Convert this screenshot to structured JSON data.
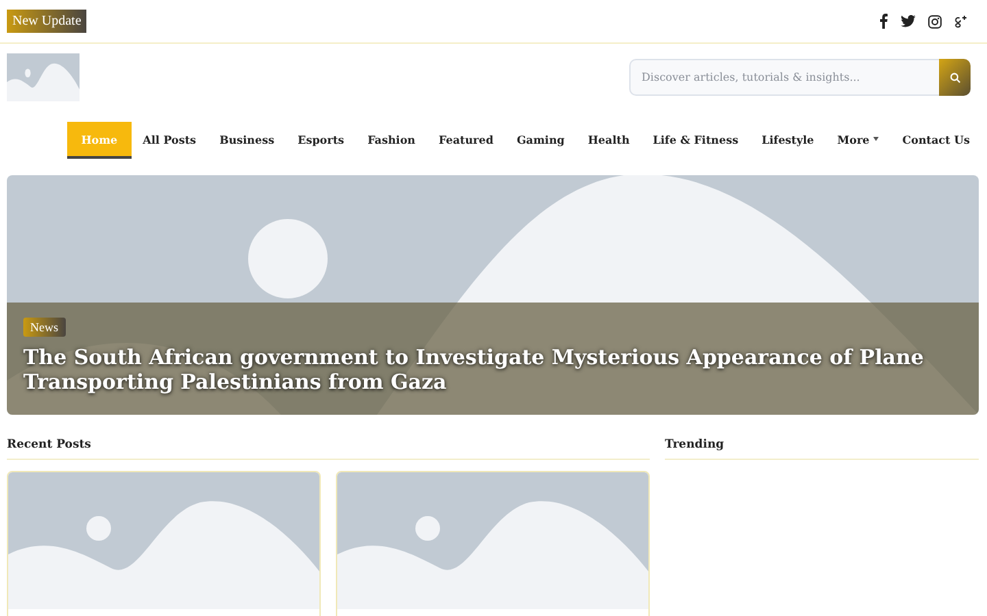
{
  "top_bar": {
    "badge": "New Update"
  },
  "search": {
    "placeholder": "Discover articles, tutorials & insights..."
  },
  "nav": [
    {
      "label": "Home",
      "selected": true,
      "dropdown": false
    },
    {
      "label": "All Posts",
      "selected": false,
      "dropdown": false
    },
    {
      "label": "Business",
      "selected": false,
      "dropdown": false
    },
    {
      "label": "Esports",
      "selected": false,
      "dropdown": false
    },
    {
      "label": "Fashion",
      "selected": false,
      "dropdown": false
    },
    {
      "label": "Featured",
      "selected": false,
      "dropdown": false
    },
    {
      "label": "Gaming",
      "selected": false,
      "dropdown": false
    },
    {
      "label": "Health",
      "selected": false,
      "dropdown": false
    },
    {
      "label": "Life & Fitness",
      "selected": false,
      "dropdown": false
    },
    {
      "label": "Lifestyle",
      "selected": false,
      "dropdown": false
    },
    {
      "label": "More",
      "selected": false,
      "dropdown": true
    },
    {
      "label": "Contact Us",
      "selected": false,
      "dropdown": false
    }
  ],
  "hero": {
    "tag": "News",
    "title": "The South African government to Investigate Mysterious Appearance of Plane Transporting Palestinians from Gaza"
  },
  "recent_posts": {
    "heading": "Recent Posts"
  },
  "trending": {
    "heading": "Trending"
  }
}
